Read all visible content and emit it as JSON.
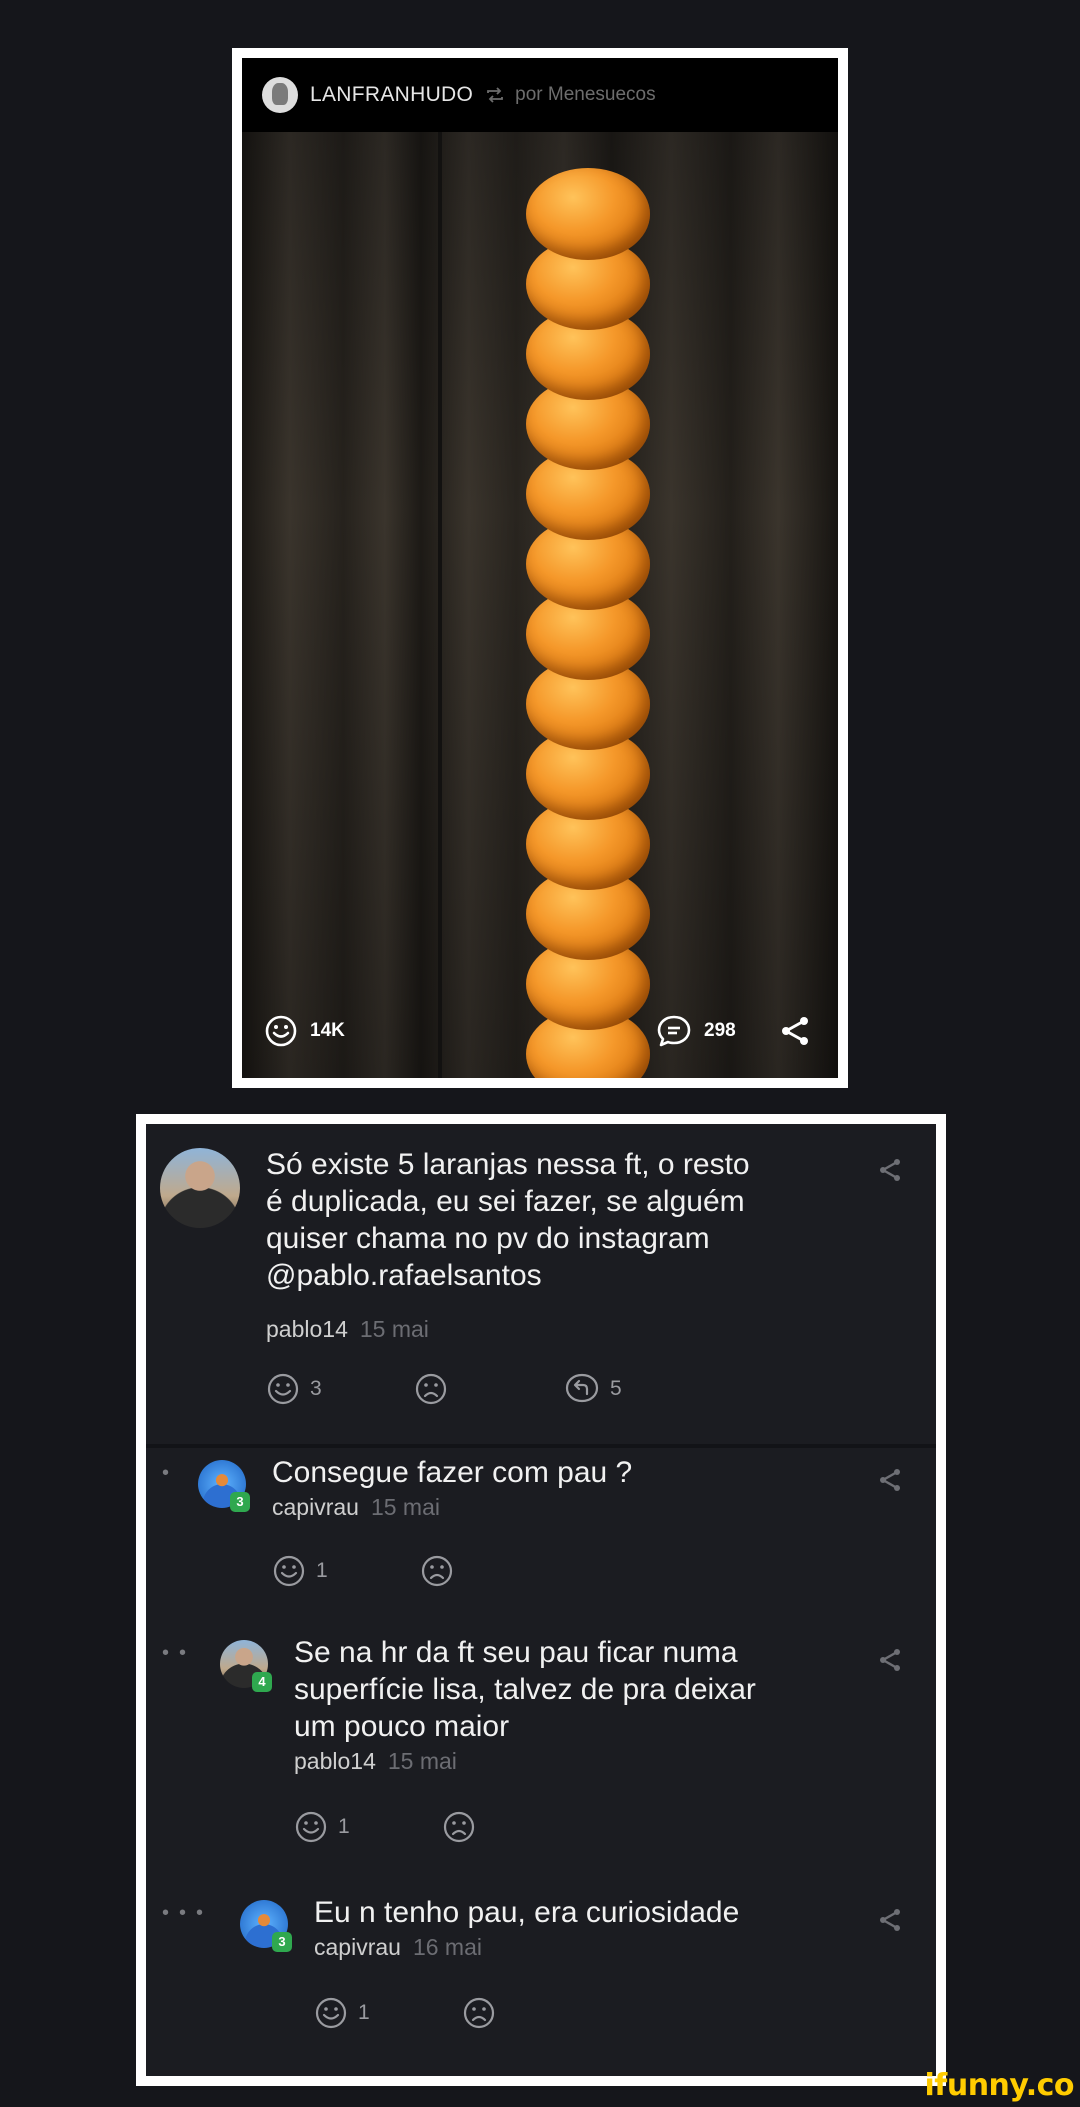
{
  "post": {
    "author": "LANFRANHUDO",
    "repost_icon": "repost-icon",
    "by_text": "por Menesuecos",
    "smiles": "14K",
    "comments": "298",
    "icons": {
      "smile": "smile-icon",
      "comment": "comment-icon",
      "share": "share-icon"
    }
  },
  "comments": [
    {
      "text": "Só existe 5 laranjas nessa ft, o resto é duplicada, eu sei fazer, se alguém quiser chama no pv do instagram @pablo.rafaelsantos",
      "lines": [
        "Só existe 5 laranjas nessa ft, o resto",
        "é duplicada, eu sei fazer, se alguém",
        "quiser chama no pv do instagram",
        "@pablo.rafaelsantos"
      ],
      "user": "pablo14",
      "date": "15 mai",
      "smiles": "3",
      "replies": "5",
      "depth": 0
    },
    {
      "lines": [
        "Consegue fazer com pau ?"
      ],
      "user": "capivrau",
      "date": "15 mai",
      "smiles": "1",
      "badge": "3",
      "depth": 1
    },
    {
      "lines": [
        "Se na hr da ft seu pau ficar numa",
        "superfície lisa, talvez de pra deixar",
        "um pouco maior"
      ],
      "user": "pablo14",
      "date": "15 mai",
      "smiles": "1",
      "badge": "4",
      "depth": 2
    },
    {
      "lines": [
        "Eu n tenho pau, era curiosidade"
      ],
      "user": "capivrau",
      "date": "16 mai",
      "smiles": "1",
      "badge": "3",
      "depth": 3
    }
  ],
  "watermark": "ifunny.co",
  "colors": {
    "background": "#15161b",
    "card": "#1b1c21",
    "badge": "#2fa84f",
    "watermark": "#ffcc00"
  }
}
